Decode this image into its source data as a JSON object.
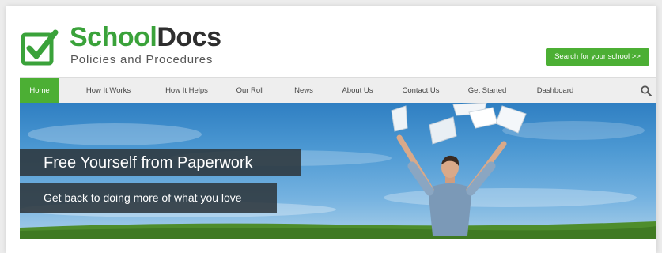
{
  "brand": {
    "name_part1": "School",
    "name_part2": "Docs",
    "tagline": "Policies and Procedures"
  },
  "header": {
    "search_school_label": "Search for your school >>"
  },
  "nav": {
    "items": [
      {
        "label": "Home",
        "active": true
      },
      {
        "label": "How It Works"
      },
      {
        "label": "How It Helps"
      },
      {
        "label": "Our Roll"
      },
      {
        "label": "News"
      },
      {
        "label": "About Us"
      },
      {
        "label": "Contact Us"
      },
      {
        "label": "Get Started"
      },
      {
        "label": "Dashboard"
      }
    ],
    "search_icon": "search-icon"
  },
  "hero": {
    "title": "Free Yourself from Paperwork",
    "subtitle": "Get back to doing more of what you love"
  },
  "colors": {
    "accent": "#4caf34",
    "brand_green": "#3aa23a",
    "overlay": "#2d373c"
  }
}
